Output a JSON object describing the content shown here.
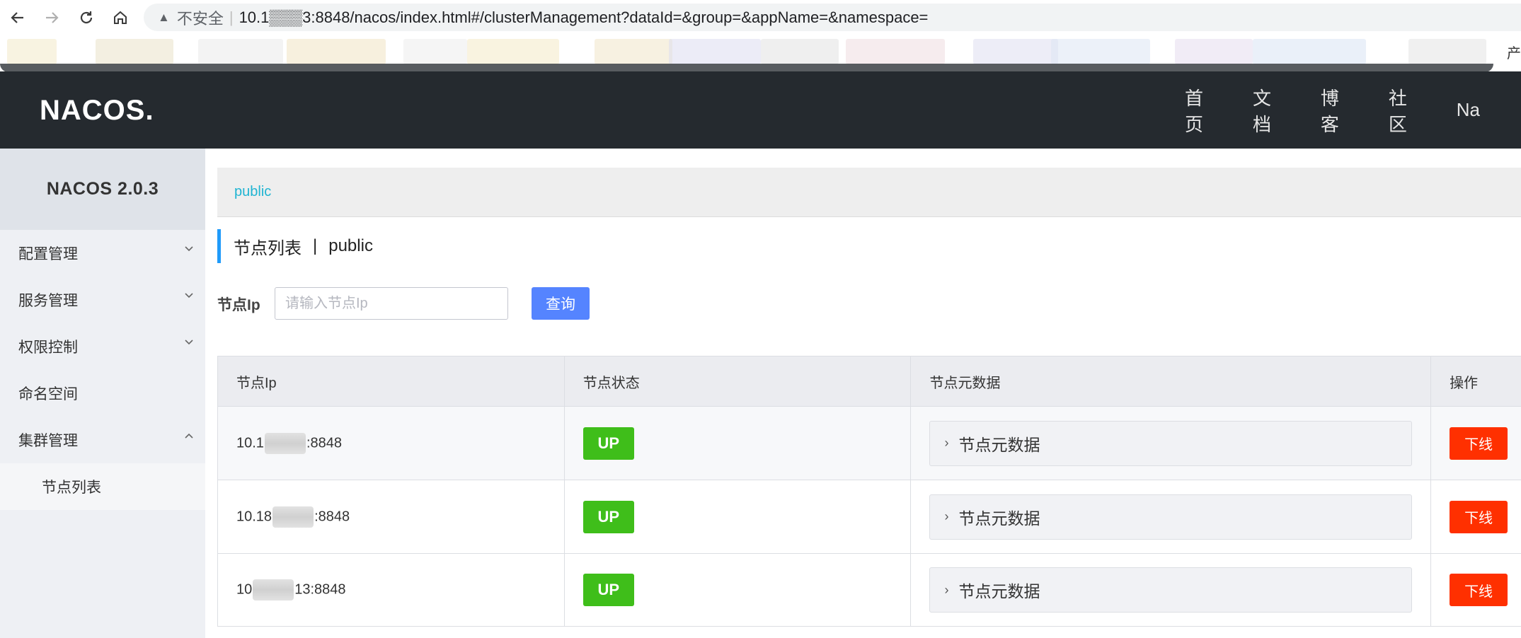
{
  "browser": {
    "insecure_label": "不安全",
    "separator": "|",
    "url": "10.1▒▒▒3:8848/nacos/index.html#/clusterManagement?dataId=&group=&appName=&namespace=",
    "bookmarks_right_text": "产"
  },
  "header": {
    "logo_text": "NACOS.",
    "nav": [
      "首页",
      "文档",
      "博客",
      "社区",
      "Na"
    ]
  },
  "sidebar": {
    "version": "NACOS 2.0.3",
    "items": [
      {
        "label": "配置管理",
        "expanded": false
      },
      {
        "label": "服务管理",
        "expanded": false
      },
      {
        "label": "权限控制",
        "expanded": false
      },
      {
        "label": "命名空间"
      },
      {
        "label": "集群管理",
        "expanded": true
      }
    ],
    "subitems": [
      "节点列表"
    ]
  },
  "main": {
    "namespace": "public",
    "title": "节点列表",
    "title_sep": "|",
    "title_ns": "public",
    "search": {
      "label": "节点Ip",
      "placeholder": "请输入节点Ip",
      "value": "",
      "button": "查询"
    },
    "table": {
      "headers": [
        "节点Ip",
        "节点状态",
        "节点元数据",
        "操作"
      ],
      "rows": [
        {
          "ip_prefix": "10.1",
          "ip_suffix": ":8848",
          "status": "UP",
          "metadata": "节点元数据",
          "action": "下线"
        },
        {
          "ip_prefix": "10.18",
          "ip_suffix": ":8848",
          "status": "UP",
          "metadata": "节点元数据",
          "action": "下线"
        },
        {
          "ip_prefix": "10",
          "ip_suffix": "13:8848",
          "status": "UP",
          "metadata": "节点元数据",
          "action": "下线"
        }
      ]
    }
  },
  "colors": {
    "header_bg": "#252a2f",
    "sidebar_bg": "#eef0f4",
    "accent_link": "#1fb4d2",
    "primary_button": "#5584ff",
    "status_up": "#3fbe1a",
    "danger_button": "#ff3000"
  }
}
